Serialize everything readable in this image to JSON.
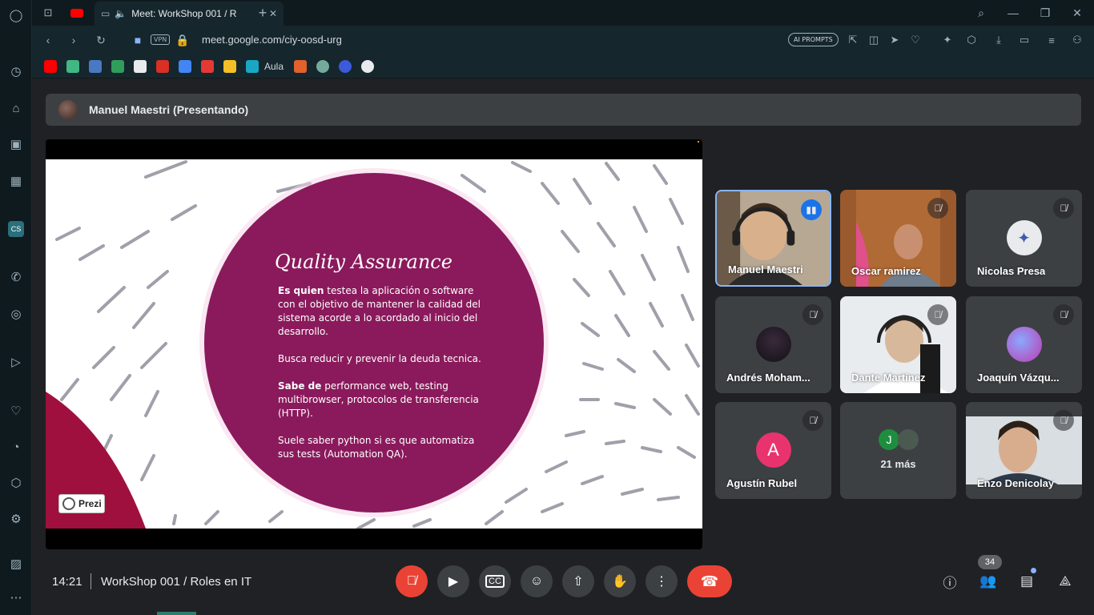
{
  "browser": {
    "tab_title": "Meet: WorkShop 001 / R",
    "url": "meet.google.com/ciy-oosd-urg",
    "vpn_label": "VPN",
    "ai_prompts_label": "AI PROMPTS",
    "bookmarks": {
      "aula_label": "Aula"
    }
  },
  "meeting": {
    "presenter_label": "Manuel Maestri (Presentando)",
    "clock": "14:21",
    "title": "WorkShop 001 / Roles en IT",
    "participant_count": "34"
  },
  "slide": {
    "title": "Quality Assurance",
    "p1_bold": "Es quien",
    "p1_text": " testea la aplicación o software con el objetivo de mantener la calidad del sistema acorde a lo acordado al inicio del desarrollo.",
    "p2_text": "Busca reducir y prevenir la deuda tecnica.",
    "p3_bold": "Sabe de",
    "p3_text": " performance web, testing multibrowser, protocolos de transferencia (HTTP).",
    "p4_text": "Suele saber python si es que automatiza sus tests (Automation QA).",
    "badge": "Prezi"
  },
  "participants": [
    {
      "name": "Manuel Maestri",
      "speaking": true
    },
    {
      "name": "Oscar ramirez",
      "muted": true
    },
    {
      "name": "Nicolas Presa",
      "muted": true
    },
    {
      "name": "Andrés Moham...",
      "muted": true
    },
    {
      "name": "Dante Martinez",
      "muted": true
    },
    {
      "name": "Joaquín Vázqu...",
      "muted": true
    },
    {
      "name": "Agustín Rubel",
      "muted": true,
      "initial": "A",
      "avatar_color": "#e8336f"
    },
    {
      "name": "21 más",
      "initial": "J",
      "avatar_color": "#1e8e3e"
    },
    {
      "name": "Enzo Denicolay",
      "muted": true
    }
  ],
  "colors": {
    "slide_circle": "#8a1a5c",
    "accent_blue": "#8ab4f8",
    "hangup_red": "#ea4335"
  }
}
